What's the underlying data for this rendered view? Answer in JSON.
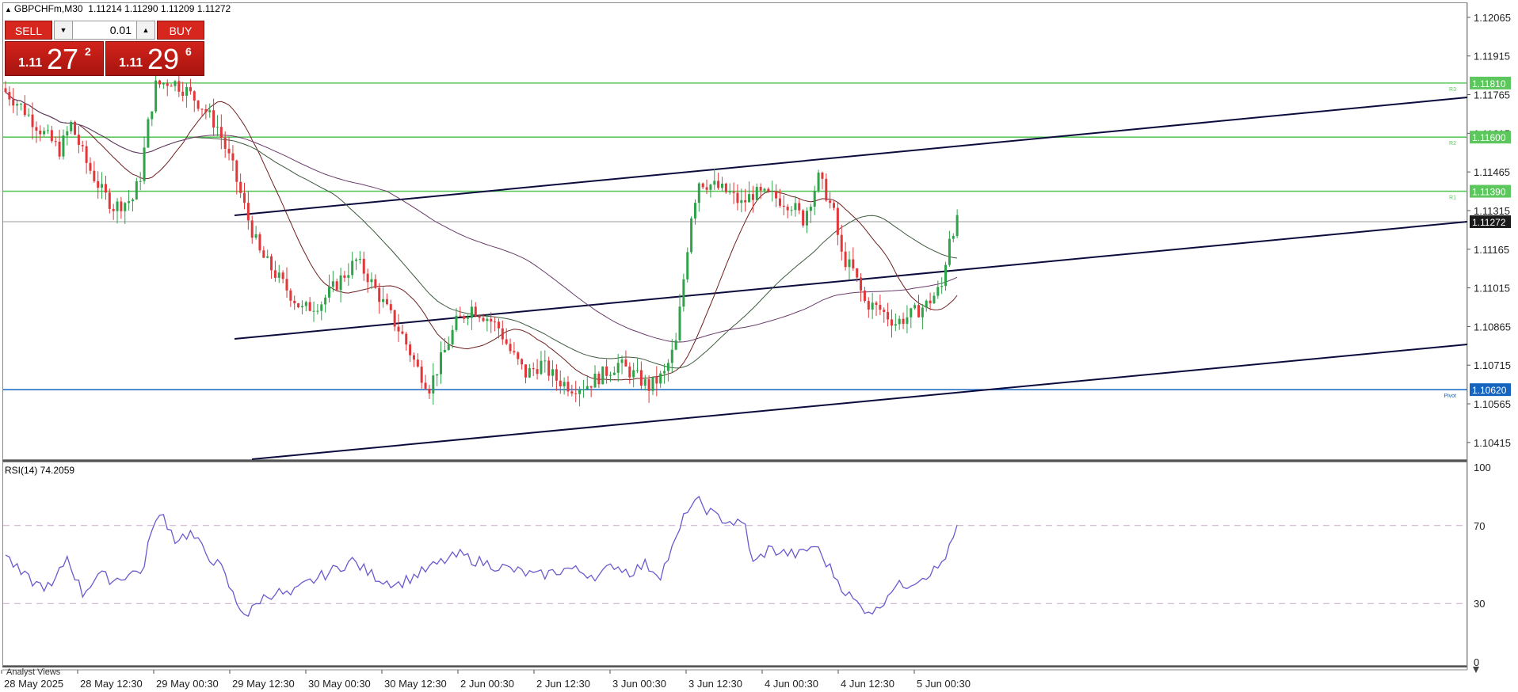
{
  "header": {
    "symbol_info": "GBPCHFm,M30  1.11214 1.11290 1.11209 1.11272"
  },
  "trade_panel": {
    "sell_label": "SELL",
    "buy_label": "BUY",
    "lot_value": "0.01",
    "sell_price": {
      "small": "1.11",
      "big": "27",
      "sup": "2"
    },
    "buy_price": {
      "small": "1.11",
      "big": "29",
      "sup": "6"
    }
  },
  "rsi": {
    "label": "RSI(14) 74.2059"
  },
  "footer": {
    "analyst_views": "Analyst Views"
  },
  "colors": {
    "bull": "#2fa34a",
    "bear": "#e0373a",
    "rsi_line": "#6a5acd",
    "level_green": "#5cc75c",
    "pivot_blue": "#1565c0",
    "current_price_tag": "#1a1a1a"
  },
  "chart_data": {
    "type": "candlestick",
    "symbol": "GBPCHFm",
    "timeframe": "M30",
    "y_ticks": [
      "1.12065",
      "1.11915",
      "1.11765",
      "1.11615",
      "1.11465",
      "1.11315",
      "1.11165",
      "1.11015",
      "1.10865",
      "1.10715",
      "1.10565",
      "1.10415"
    ],
    "y_range": [
      1.1035,
      1.1212
    ],
    "x_ticks": [
      "28 May 2025",
      "28 May 12:30",
      "29 May 00:30",
      "29 May 12:30",
      "30 May 00:30",
      "30 May 12:30",
      "2 Jun 00:30",
      "2 Jun 12:30",
      "3 Jun 00:30",
      "3 Jun 12:30",
      "4 Jun 00:30",
      "4 Jun 12:30",
      "5 Jun 00:30"
    ],
    "levels": [
      {
        "name": "R3",
        "value": 1.1181,
        "label": "1.11810",
        "color": "#5cc75c"
      },
      {
        "name": "R2",
        "value": 1.116,
        "label": "1.11600",
        "color": "#5cc75c"
      },
      {
        "name": "R1",
        "value": 1.1139,
        "label": "1.11390",
        "color": "#5cc75c"
      },
      {
        "name": "Pivot",
        "value": 1.1062,
        "label": "1.10620",
        "color": "#1565c0"
      }
    ],
    "current_price": {
      "value": 1.11272,
      "label": "1.11272"
    },
    "path_points": [
      [
        0,
        1.1179
      ],
      [
        5,
        1.1172
      ],
      [
        10,
        1.1163
      ],
      [
        15,
        1.1155
      ],
      [
        18,
        1.1165
      ],
      [
        22,
        1.115
      ],
      [
        26,
        1.1139
      ],
      [
        29,
        1.1133
      ],
      [
        34,
        1.1136
      ],
      [
        36,
        1.1145
      ],
      [
        38,
        1.1165
      ],
      [
        40,
        1.118
      ],
      [
        44,
        1.1182
      ],
      [
        48,
        1.1178
      ],
      [
        52,
        1.1172
      ],
      [
        56,
        1.1164
      ],
      [
        60,
        1.1148
      ],
      [
        64,
        1.1128
      ],
      [
        67,
        1.1115
      ],
      [
        72,
        1.1105
      ],
      [
        78,
        1.1093
      ],
      [
        83,
        1.1096
      ],
      [
        88,
        1.1105
      ],
      [
        92,
        1.1112
      ],
      [
        95,
        1.1106
      ],
      [
        100,
        1.1093
      ],
      [
        104,
        1.1083
      ],
      [
        108,
        1.107
      ],
      [
        111,
        1.1063
      ],
      [
        115,
        1.1077
      ],
      [
        118,
        1.1088
      ],
      [
        122,
        1.1094
      ],
      [
        126,
        1.109
      ],
      [
        129,
        1.1086
      ],
      [
        132,
        1.1077
      ],
      [
        136,
        1.1068
      ],
      [
        140,
        1.1072
      ],
      [
        144,
        1.1066
      ],
      [
        148,
        1.1063
      ],
      [
        152,
        1.1064
      ],
      [
        156,
        1.1068
      ],
      [
        160,
        1.1072
      ],
      [
        164,
        1.1068
      ],
      [
        168,
        1.1063
      ],
      [
        172,
        1.1068
      ],
      [
        175,
        1.108
      ],
      [
        177,
        1.1105
      ],
      [
        179,
        1.113
      ],
      [
        181,
        1.1143
      ],
      [
        185,
        1.1141
      ],
      [
        189,
        1.1138
      ],
      [
        192,
        1.1134
      ],
      [
        195,
        1.1138
      ],
      [
        200,
        1.1137
      ],
      [
        205,
        1.1134
      ],
      [
        208,
        1.1128
      ],
      [
        212,
        1.1144
      ],
      [
        214,
        1.1138
      ],
      [
        216,
        1.113
      ],
      [
        218,
        1.1114
      ],
      [
        221,
        1.1108
      ],
      [
        224,
        1.1096
      ],
      [
        228,
        1.1093
      ],
      [
        232,
        1.1088
      ],
      [
        236,
        1.1091
      ],
      [
        240,
        1.1095
      ],
      [
        244,
        1.1102
      ],
      [
        246,
        1.1122
      ],
      [
        248,
        1.1127
      ]
    ],
    "candle_count": 248,
    "rsi": {
      "period": 14,
      "value": 74.2059,
      "levels": [
        70,
        30
      ],
      "y_ticks": [
        "100",
        "70",
        "30",
        "0"
      ],
      "points": [
        [
          0,
          55
        ],
        [
          4,
          45
        ],
        [
          8,
          40
        ],
        [
          12,
          38
        ],
        [
          16,
          54
        ],
        [
          20,
          35
        ],
        [
          24,
          45
        ],
        [
          28,
          42
        ],
        [
          32,
          45
        ],
        [
          36,
          48
        ],
        [
          38,
          70
        ],
        [
          41,
          75
        ],
        [
          44,
          63
        ],
        [
          48,
          66
        ],
        [
          52,
          56
        ],
        [
          56,
          48
        ],
        [
          60,
          30
        ],
        [
          63,
          24
        ],
        [
          66,
          32
        ],
        [
          70,
          36
        ],
        [
          74,
          34
        ],
        [
          78,
          40
        ],
        [
          82,
          44
        ],
        [
          86,
          48
        ],
        [
          90,
          52
        ],
        [
          94,
          46
        ],
        [
          98,
          42
        ],
        [
          102,
          40
        ],
        [
          106,
          44
        ],
        [
          110,
          48
        ],
        [
          114,
          52
        ],
        [
          118,
          55
        ],
        [
          122,
          52
        ],
        [
          126,
          50
        ],
        [
          130,
          48
        ],
        [
          134,
          46
        ],
        [
          138,
          44
        ],
        [
          142,
          46
        ],
        [
          146,
          48
        ],
        [
          150,
          46
        ],
        [
          154,
          44
        ],
        [
          158,
          50
        ],
        [
          162,
          46
        ],
        [
          166,
          50
        ],
        [
          170,
          45
        ],
        [
          174,
          62
        ],
        [
          177,
          79
        ],
        [
          180,
          82
        ],
        [
          184,
          75
        ],
        [
          188,
          72
        ],
        [
          192,
          70
        ],
        [
          194,
          50
        ],
        [
          198,
          58
        ],
        [
          202,
          56
        ],
        [
          206,
          55
        ],
        [
          210,
          60
        ],
        [
          214,
          48
        ],
        [
          218,
          36
        ],
        [
          222,
          28
        ],
        [
          226,
          26
        ],
        [
          230,
          38
        ],
        [
          234,
          40
        ],
        [
          238,
          44
        ],
        [
          242,
          48
        ],
        [
          245,
          58
        ],
        [
          248,
          74
        ]
      ]
    }
  }
}
